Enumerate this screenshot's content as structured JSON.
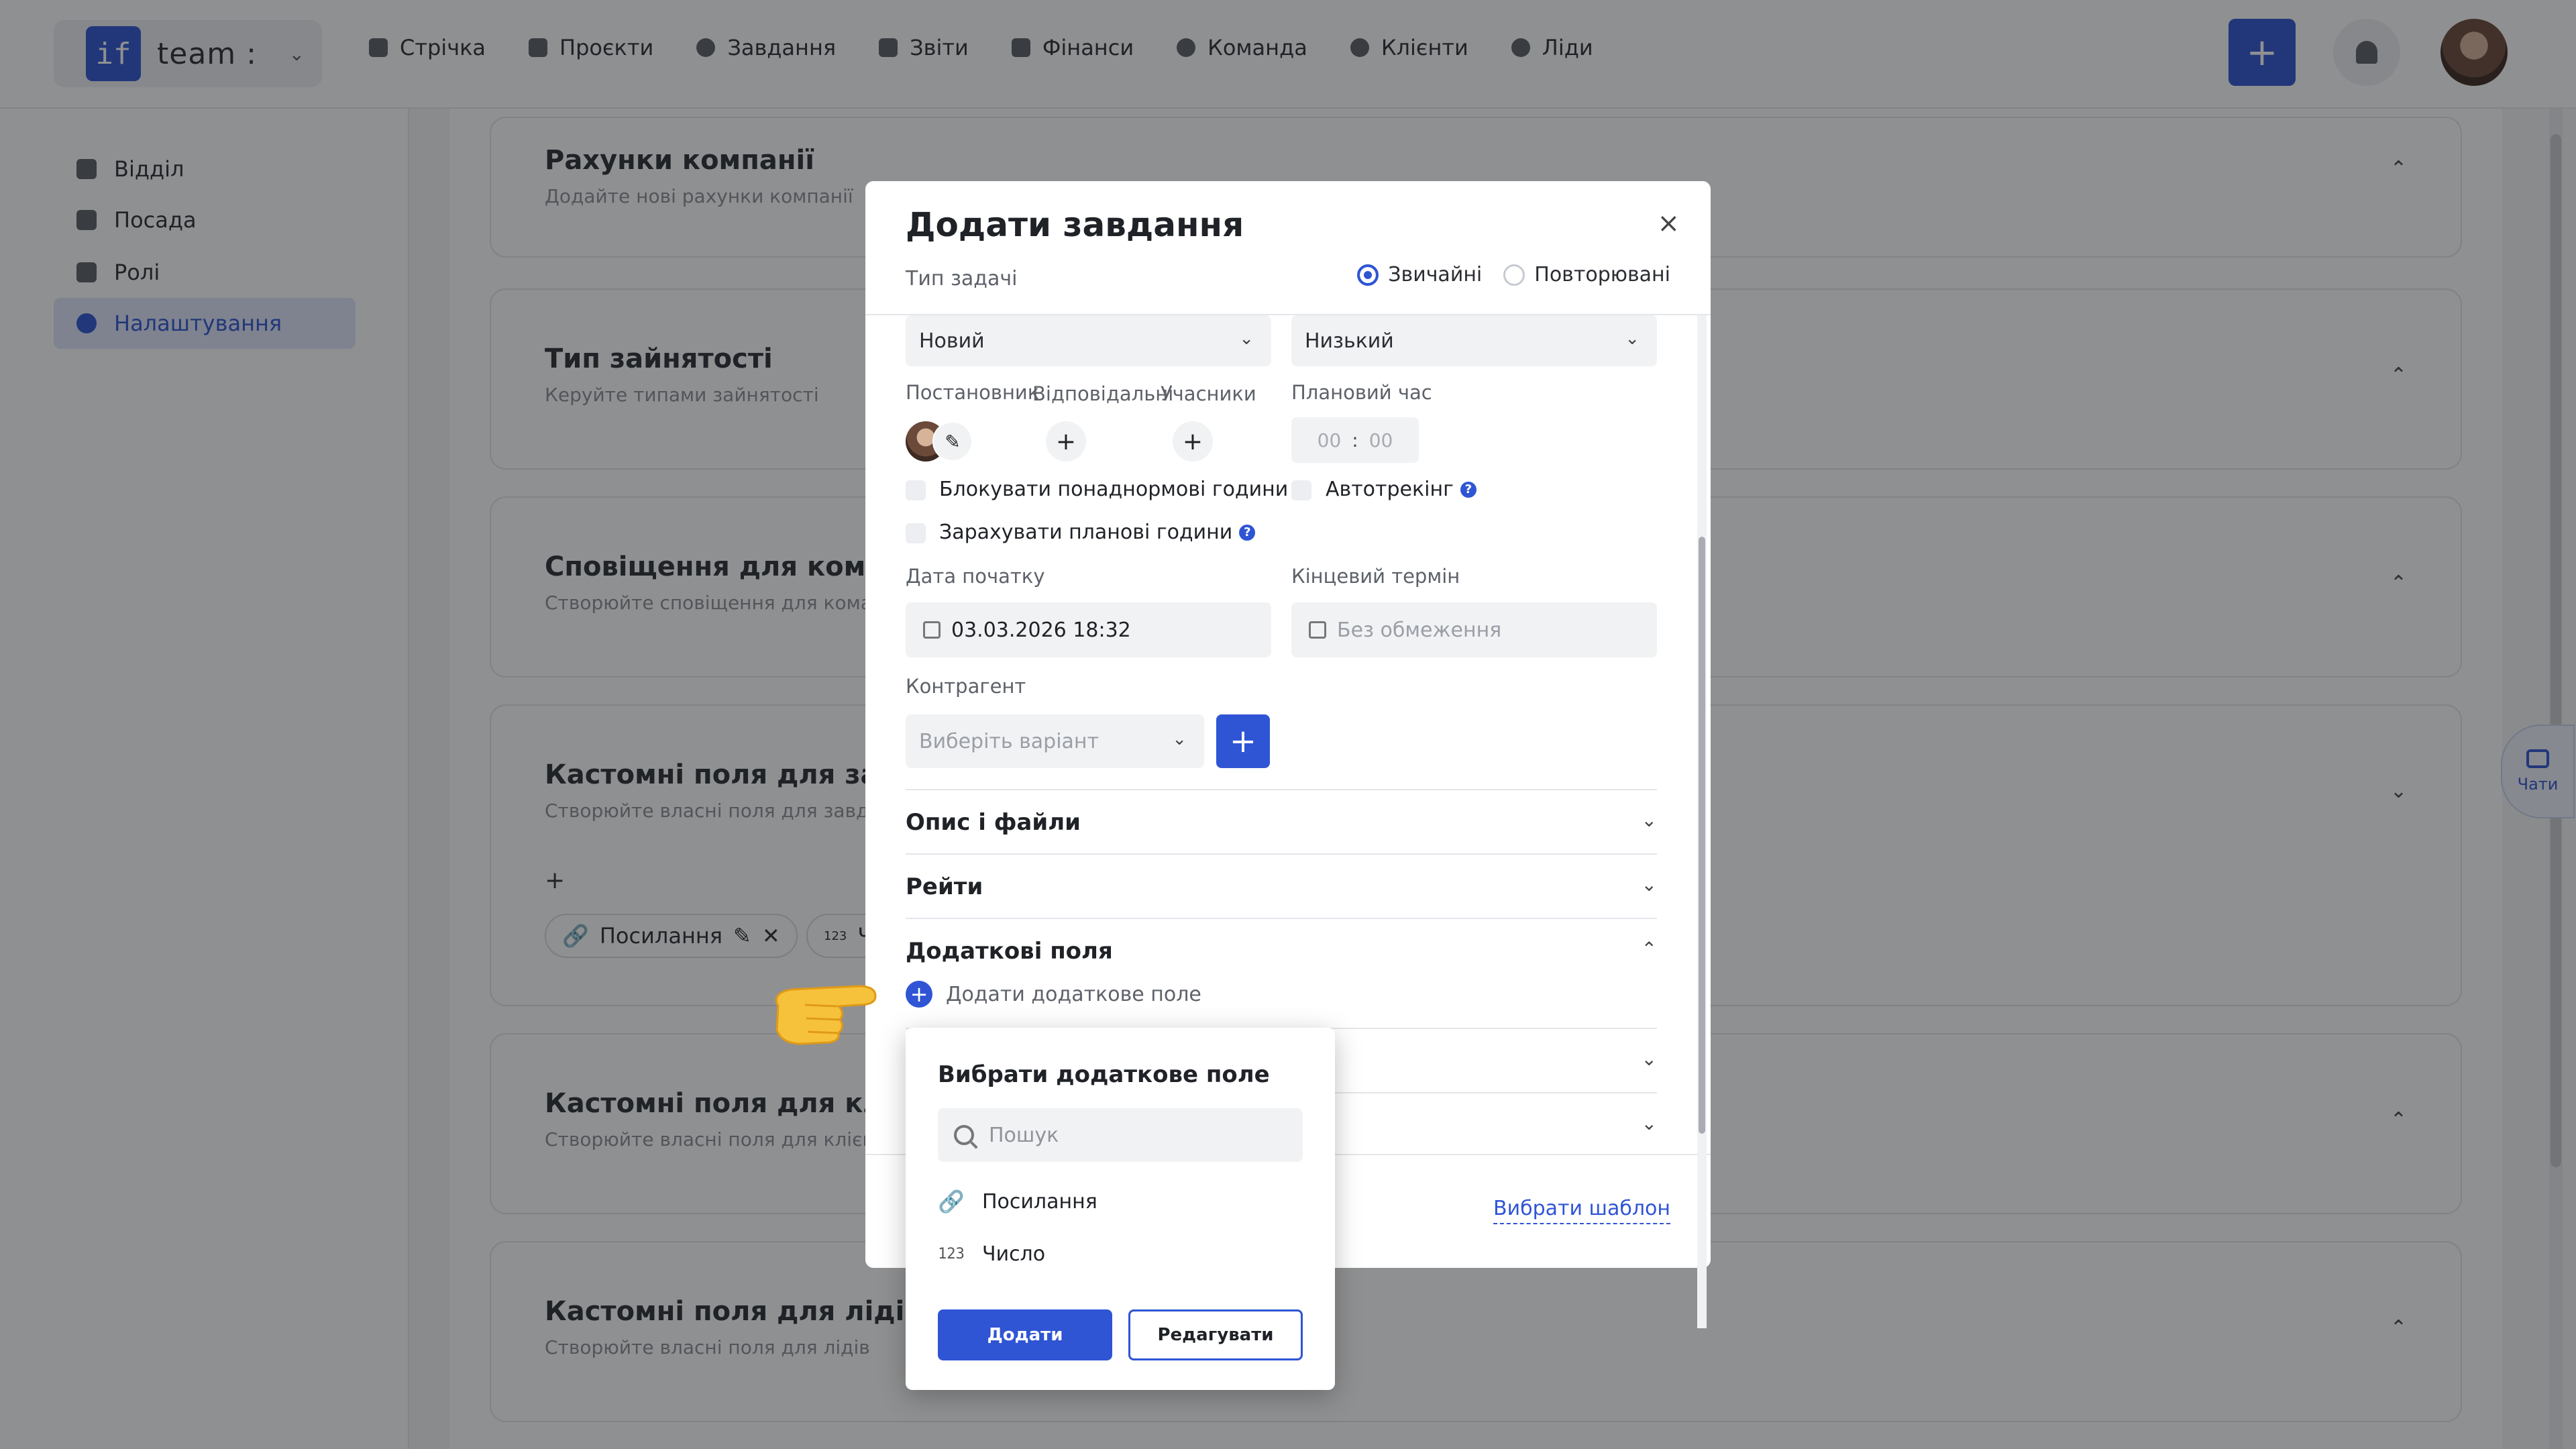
{
  "brand": {
    "logo": "if",
    "name": "team :"
  },
  "nav": [
    "Стрічка",
    "Проєкти",
    "Завдання",
    "Звіти",
    "Фінанси",
    "Команда",
    "Клієнти",
    "Ліди"
  ],
  "nav_icons": [
    "home-icon",
    "file-icon",
    "check-circle-icon",
    "report-icon",
    "finance-icon",
    "user-icon",
    "clients-icon",
    "leads-icon"
  ],
  "sidebar": {
    "items": [
      {
        "label": "Відділ",
        "icon": "department-icon"
      },
      {
        "label": "Посада",
        "icon": "position-icon"
      },
      {
        "label": "Ролі",
        "icon": "key-icon"
      },
      {
        "label": "Налаштування",
        "icon": "gear-icon",
        "active": true
      }
    ]
  },
  "cards": [
    {
      "title": "Рахунки компанії",
      "subtitle": "Додайте нові рахунки компанії"
    },
    {
      "title": "Тип зайнятості",
      "subtitle": "Керуйте типами зайнятості"
    },
    {
      "title": "Сповіщення для команди",
      "subtitle": "Створюйте сповіщення для команд"
    },
    {
      "title": "Кастомні поля для завда",
      "subtitle": "Створюйте власні поля для завдан",
      "chips": [
        "Посилання",
        "Чи"
      ]
    },
    {
      "title": "Кастомні поля для клієнт",
      "subtitle": "Створюйте власні поля для клієнті"
    },
    {
      "title": "Кастомні поля для лідів",
      "subtitle": "Створюйте власні поля для лідів"
    }
  ],
  "chats_label": "Чати",
  "modal": {
    "title": "Додати завдання",
    "close": "×",
    "type_label": "Тип задачі",
    "type_options": [
      "Звичайні",
      "Повторювані"
    ],
    "type_selected": "Звичайні",
    "status_value": "Новий",
    "priority_value": "Низький",
    "labels": {
      "creator": "Постановник",
      "responsible": "Відповідальні",
      "participants": "Учасники",
      "planned_time": "Плановий час",
      "start_date": "Дата початку",
      "deadline": "Кінцевий термін",
      "contractor": "Контрагент"
    },
    "planned_time": {
      "hours": "00",
      "separator": ":",
      "minutes": "00"
    },
    "checkboxes": {
      "block_overtime": "Блокувати понаднормові години",
      "autotracking": "Автотрекінг",
      "count_planned": "Зарахувати планові години"
    },
    "start_date_value": "03.03.2026 18:32",
    "deadline_placeholder": "Без обмеження",
    "contractor_placeholder": "Виберіть варіант",
    "sections": [
      "Опис і файли",
      "Рейти",
      "Додаткові поля"
    ],
    "add_field_label": "Додати додаткове поле",
    "template_link": "Вибрати шаблон"
  },
  "dropdown": {
    "title": "Вибрати додаткове поле",
    "search_placeholder": "Пошук",
    "options": [
      {
        "label": "Посилання",
        "icon": "link-icon"
      },
      {
        "label": "Число",
        "icon": "number-icon",
        "icon_text": "123"
      }
    ],
    "add_button": "Додати",
    "edit_button": "Редагувати"
  },
  "colors": {
    "accent": "#2f55d4",
    "overlay": "rgba(20,22,26,0.48)"
  }
}
